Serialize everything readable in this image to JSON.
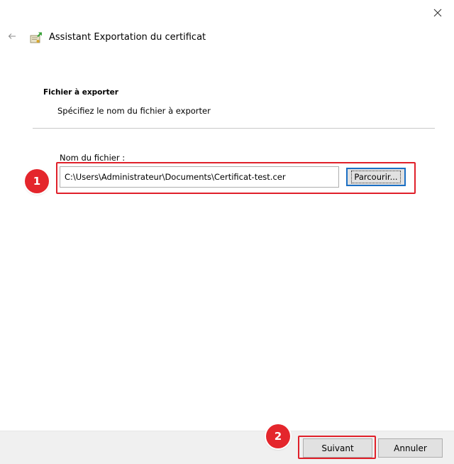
{
  "window": {
    "title": "Assistant Exportation du certificat",
    "close_icon": "close-icon",
    "back_icon": "back-arrow-icon",
    "app_icon": "certificate-wizard-icon"
  },
  "section": {
    "title": "Fichier à exporter",
    "description": "Spécifiez le nom du fichier à exporter"
  },
  "file_field": {
    "label": "Nom du fichier :",
    "value": "C:\\Users\\Administrateur\\Documents\\Certificat-test.cer",
    "browse_label": "Parcourir..."
  },
  "annotations": {
    "step1": "1",
    "step2": "2",
    "highlight_color": "#e0202a"
  },
  "footer": {
    "next_label": "Suivant",
    "cancel_label": "Annuler"
  }
}
